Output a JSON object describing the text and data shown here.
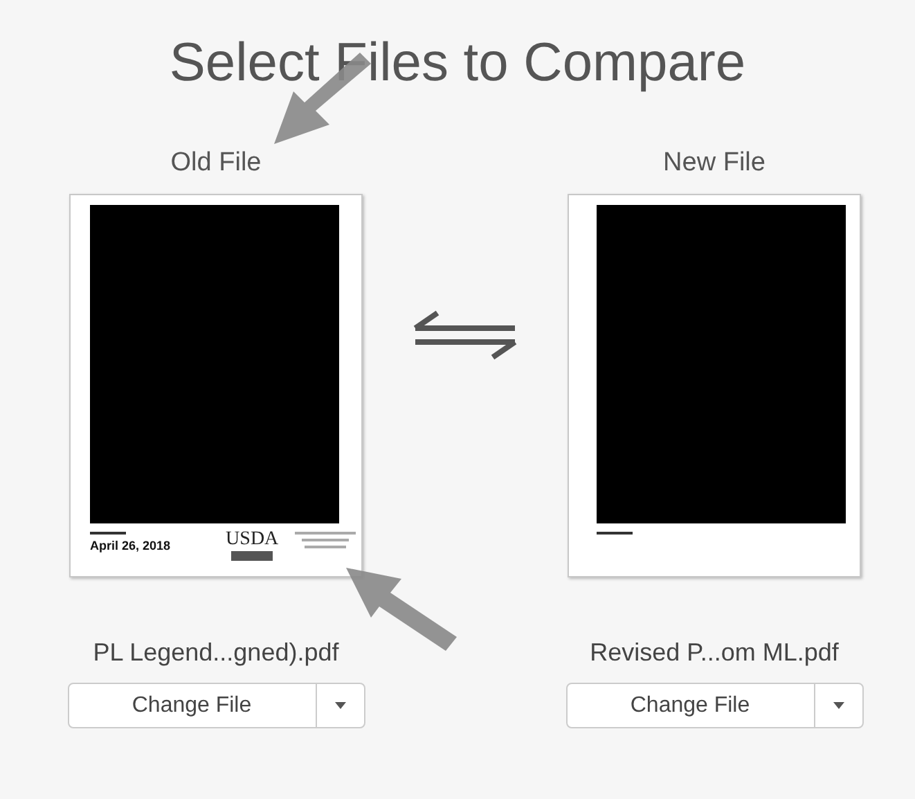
{
  "title": "Select Files to Compare",
  "files": [
    {
      "label": "Old File",
      "date": "April 26, 2018",
      "logo": "USDA",
      "filename": "PL Legend...gned).pdf",
      "button": "Change File"
    },
    {
      "label": "New File",
      "filename": "Revised P...om ML.pdf",
      "button": "Change File"
    }
  ]
}
